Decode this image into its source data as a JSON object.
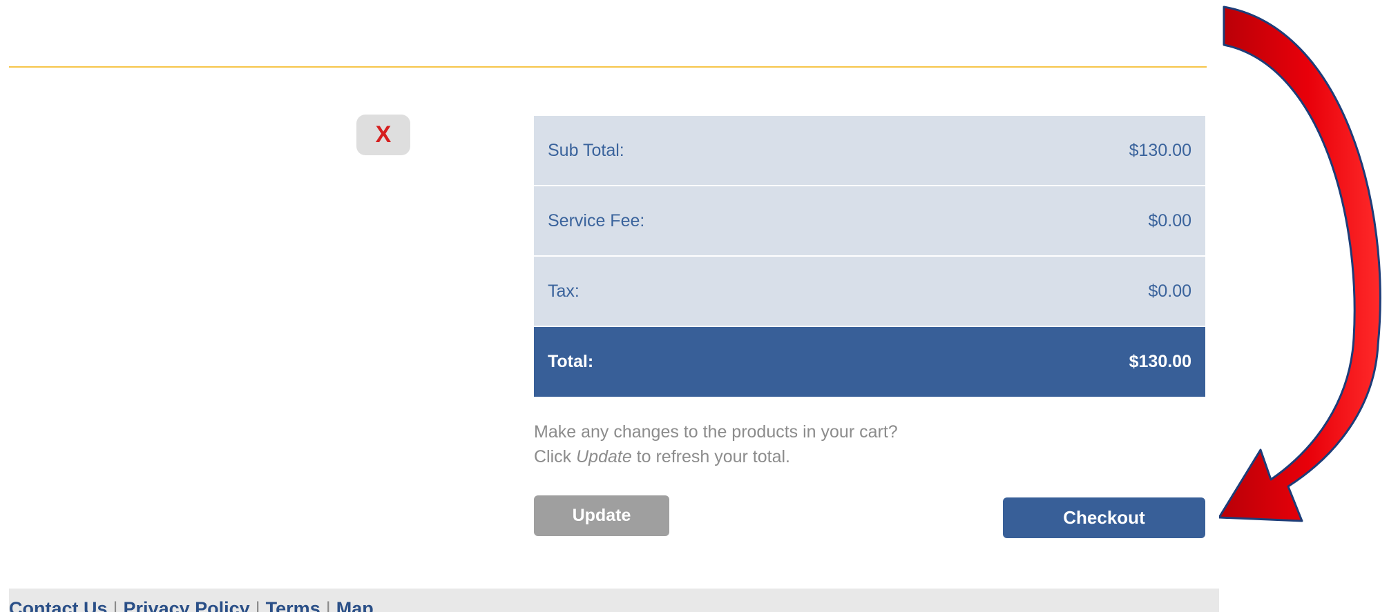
{
  "cart": {
    "remove_label": "X"
  },
  "summary": {
    "rows": [
      {
        "label": "Sub Total:",
        "value": "$130.00"
      },
      {
        "label": "Service Fee:",
        "value": "$0.00"
      },
      {
        "label": "Tax:",
        "value": "$0.00"
      }
    ],
    "total": {
      "label": "Total:",
      "value": "$130.00"
    }
  },
  "note": {
    "line1": "Make any changes to the products in your cart?",
    "line2_before": "Click ",
    "line2_em": "Update",
    "line2_after": " to refresh your total."
  },
  "buttons": {
    "update": "Update",
    "checkout": "Checkout"
  },
  "footer": {
    "links": [
      "Contact Us",
      "Privacy Policy",
      "Terms",
      "Map"
    ],
    "separator": "|"
  },
  "colors": {
    "accent": "#385f98",
    "row_bg": "#d8dfe9",
    "rule": "#f6c54a",
    "arrow": "#e8000a"
  }
}
